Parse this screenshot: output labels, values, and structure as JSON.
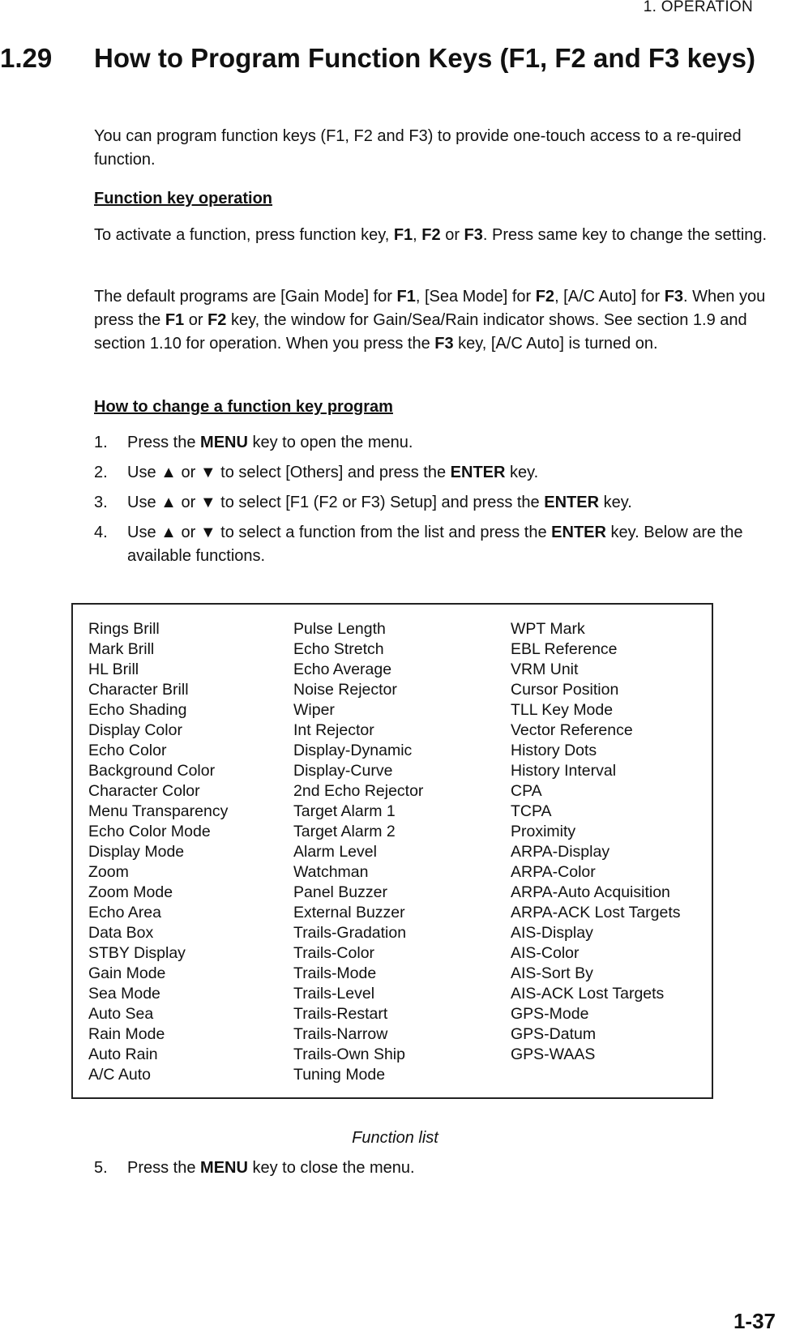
{
  "header": {
    "running_title": "1.  OPERATION"
  },
  "section": {
    "number": "1.29",
    "title": "How to Program Function Keys (F1, F2 and F3 keys)"
  },
  "intro": "You can program function keys (F1, F2 and F3) to provide one-touch access to a re-quired function.",
  "function_key_operation": {
    "heading": "Function key operation",
    "para1": {
      "t1": "To activate a function, press function key, ",
      "k1": "F1",
      "t2": ", ",
      "k2": "F2",
      "t3": " or ",
      "k3": "F3",
      "t4": ". Press same key to change the setting."
    },
    "para2": {
      "t1": "The default programs are [Gain Mode] for ",
      "k1": "F1",
      "t2": ", [Sea Mode] for ",
      "k2": "F2",
      "t3": ", [A/C Auto] for ",
      "k3": "F3",
      "t4": ". When you press the ",
      "k4": "F1",
      "t5": " or ",
      "k5": "F2",
      "t6": " key, the window for Gain/Sea/Rain indicator shows. See section 1.9 and section 1.10 for operation. When you press the ",
      "k6": "F3",
      "t7": " key, [A/C Auto] is turned on."
    }
  },
  "change_program": {
    "heading": "How to change a function key program",
    "steps": [
      {
        "num": "1.",
        "t1": "Press the ",
        "k1": "MENU",
        "t2": " key to open the menu."
      },
      {
        "num": "2.",
        "t1": "Use ▲ or ▼ to select [Others] and press the ",
        "k1": "ENTER",
        "t2": " key."
      },
      {
        "num": "3.",
        "t1": "Use ▲ or ▼ to select [F1 (F2 or F3) Setup] and press the ",
        "k1": "ENTER",
        "t2": " key."
      },
      {
        "num": "4.",
        "t1": "Use ▲ or ▼ to select a function from the list and press the ",
        "k1": "ENTER",
        "t2": " key. Below are the available functions."
      },
      {
        "num": "5.",
        "t1": "Press the ",
        "k1": "MENU",
        "t2": " key to close the menu."
      }
    ]
  },
  "function_list": {
    "caption": "Function list",
    "columns": [
      [
        "Rings Brill",
        "Mark Brill",
        "HL Brill",
        "Character Brill",
        "Echo Shading",
        "Display Color",
        "Echo Color",
        "Background Color",
        "Character Color",
        "Menu Transparency",
        "Echo Color Mode",
        "Display Mode",
        "Zoom",
        "Zoom Mode",
        "Echo Area",
        "Data Box",
        "STBY Display",
        "Gain Mode",
        "Sea Mode",
        "Auto Sea",
        "Rain Mode",
        "Auto Rain",
        "A/C Auto"
      ],
      [
        "Pulse Length",
        "Echo Stretch",
        "Echo Average",
        "Noise Rejector",
        "Wiper",
        "Int Rejector",
        "Display-Dynamic",
        "Display-Curve",
        "2nd Echo Rejector",
        "Target Alarm 1",
        "Target Alarm 2",
        "Alarm Level",
        "Watchman",
        "Panel Buzzer",
        "External Buzzer",
        "Trails-Gradation",
        "Trails-Color",
        "Trails-Mode",
        "Trails-Level",
        "Trails-Restart",
        "Trails-Narrow",
        "Trails-Own Ship",
        "Tuning Mode"
      ],
      [
        "WPT Mark",
        "EBL Reference",
        "VRM Unit",
        "Cursor Position",
        "TLL Key Mode",
        "Vector Reference",
        "History Dots",
        "History Interval",
        "CPA",
        "TCPA",
        "Proximity",
        "ARPA-Display",
        "ARPA-Color",
        "ARPA-Auto Acquisition",
        "ARPA-ACK Lost Targets",
        "AIS-Display",
        "AIS-Color",
        "AIS-Sort By",
        "AIS-ACK Lost Targets",
        "GPS-Mode",
        "GPS-Datum",
        "GPS-WAAS"
      ]
    ]
  },
  "footer": {
    "page_number": "1-37"
  }
}
